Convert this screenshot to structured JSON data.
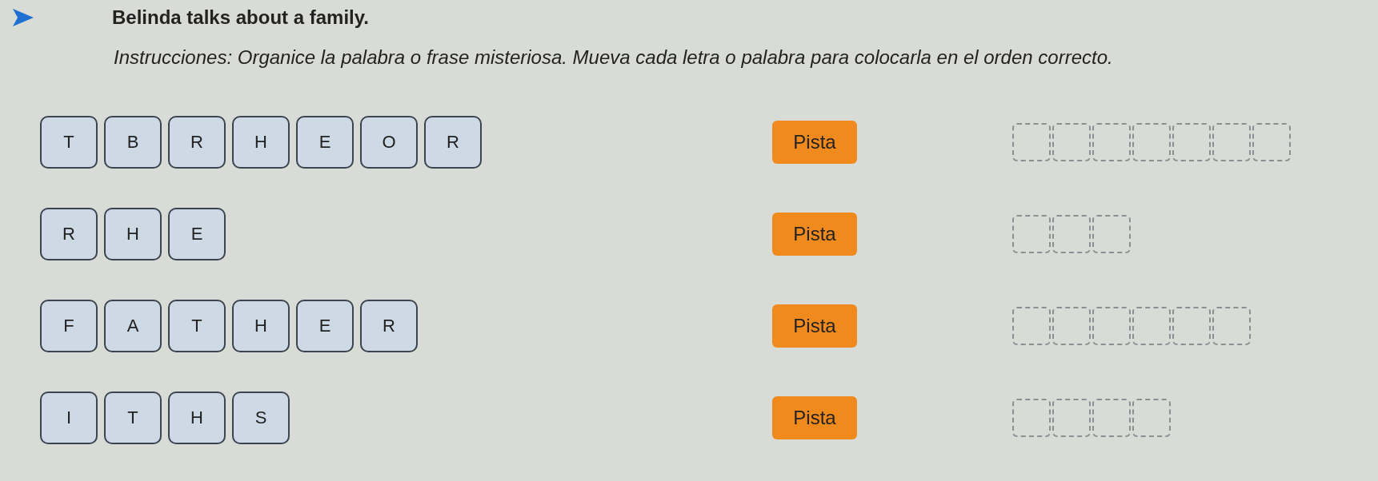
{
  "title": "Belinda talks about a family.",
  "instructions": "*Instrucciones: Organice la palabra o frase misteriosa. Mueva cada letra o palabra para colocarla en el orden correcto.*",
  "puzzles": [
    {
      "tiles": [
        "T",
        "B",
        "R",
        "H",
        "E",
        "O",
        "R"
      ],
      "hint_button": "Pista"
    },
    {
      "tiles": [
        "R",
        "H",
        "E"
      ],
      "hint_button": "Pista"
    },
    {
      "tiles": [
        "F",
        "A",
        "T",
        "H",
        "E",
        "R"
      ],
      "hint_button": "Pista"
    },
    {
      "tiles": [
        "I",
        "T",
        "H",
        "S"
      ],
      "hint_button": "Pista"
    }
  ]
}
